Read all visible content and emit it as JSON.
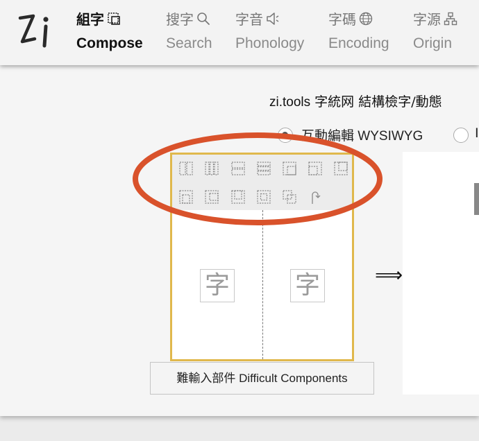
{
  "logo": {
    "text": "zi"
  },
  "nav": [
    {
      "zh": "組字",
      "en": "Compose",
      "icon": "compose-icon",
      "active": true
    },
    {
      "zh": "搜字",
      "en": "Search",
      "icon": "search-icon",
      "active": false
    },
    {
      "zh": "字音",
      "en": "Phonology",
      "icon": "speaker-icon",
      "active": false
    },
    {
      "zh": "字碼",
      "en": "Encoding",
      "icon": "globe-icon",
      "active": false
    },
    {
      "zh": "字源",
      "en": "Origin",
      "icon": "hierarchy-icon",
      "active": false
    }
  ],
  "subtitle": {
    "latin": "zi.tools",
    "zh": " 字統网 結構檢字/動態"
  },
  "mode": {
    "option1": {
      "zh": "互動編輯",
      "en": " WYSIWYG",
      "selected": true
    },
    "option2": {
      "label": "I",
      "selected": false
    }
  },
  "toolbar": {
    "icons": [
      "left-right-layout-icon",
      "left-middle-right-layout-icon",
      "top-bottom-layout-icon",
      "top-middle-bottom-layout-icon",
      "surround-upper-left-icon",
      "surround-upper-right-icon",
      "surround-lower-left-icon",
      "surround-from-below-icon",
      "surround-from-left-icon",
      "surround-from-above-icon",
      "full-surround-icon",
      "overlay-icon",
      "rotate-icon"
    ]
  },
  "slots": {
    "left": "字",
    "right": "字"
  },
  "arrow": "⟹",
  "difficult_button": {
    "zh": "難輸入部件",
    "en": " Difficult Components"
  },
  "colors": {
    "accent_border": "#e0b84c",
    "annotation": "#d9522b"
  }
}
